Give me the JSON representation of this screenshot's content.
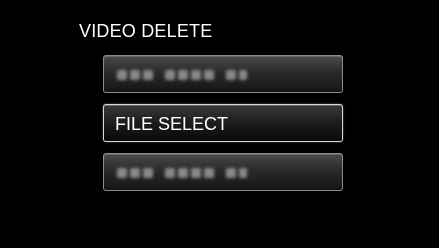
{
  "screen": {
    "title": "VIDEO DELETE"
  },
  "menu": {
    "items": [
      {
        "label": "",
        "state": "blurred"
      },
      {
        "label": "FILE SELECT",
        "state": "selected"
      },
      {
        "label": "",
        "state": "blurred"
      }
    ]
  },
  "colors": {
    "background": "#000000",
    "text": "#ffffff",
    "button_border": "#8c8c8c",
    "selected_border": "#d8d8d8"
  }
}
